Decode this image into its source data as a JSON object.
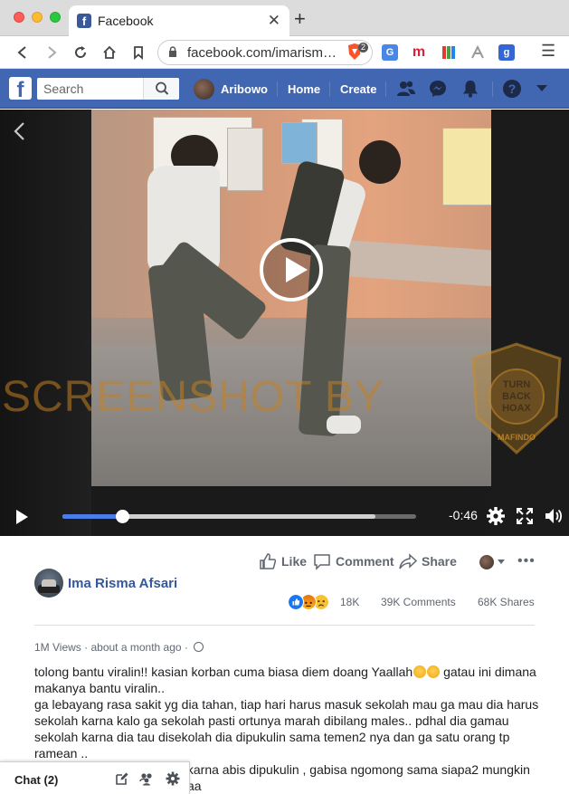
{
  "browser": {
    "tab_title": "Facebook",
    "tab_close": "✕",
    "new_tab": "+",
    "url": "facebook.com/imarism…",
    "brave_badge": "2",
    "menu": "☰"
  },
  "fb_header": {
    "logo": "f",
    "search_placeholder": "Search",
    "user_name": "Aribowo",
    "home_label": "Home",
    "create_label": "Create"
  },
  "video": {
    "time_remaining": "-0:46",
    "progress": 0.17,
    "buffered": 0.885,
    "watermark": "SCREENSHOT BY",
    "seal_text_top": "MASYARAKAT ANTI FITNAH INDONESIA",
    "seal_center": [
      "TURN",
      "BACK",
      "HOAX"
    ],
    "seal_bottom": "MAFINDO"
  },
  "post": {
    "actions": {
      "like": "Like",
      "comment": "Comment",
      "share": "Share"
    },
    "author": "Ima Risma Afsari",
    "reaction_count": "18K",
    "comment_count": "39K Comments",
    "share_count": "68K Shares",
    "views": "1M Views",
    "time": "about a month ago",
    "paragraph1_line1": "tolong bantu viralin!! kasian korban cuma biasa diem doang Yaallah",
    "paragraph1_line1_after": " gatau ini dimana",
    "paragraph1_line2": "makanya bantu viralin..",
    "paragraph2": [
      "ga lebayang rasa sakit yg dia tahan, tiap hari harus masuk sekolah mau ga mau dia harus",
      "sekolah karna kalo ga sekolah pasti ortunya marah dibilang males.. pdhal dia gamau",
      "sekolah karna dia tau disekolah dia dipukulin sama temen2 nya dan ga satu orang tp",
      "ramean .."
    ],
    "paragraph3_line1": "it karna abis dipukulin , gabisa ngomong sama siapa2 mungkin",
    "paragraph3_line2": "aa"
  },
  "chat": {
    "label": "Chat (2)"
  },
  "colors": {
    "facebook_blue": "#4267b2",
    "link_blue": "#365899",
    "progress_blue": "#4a7de8"
  }
}
